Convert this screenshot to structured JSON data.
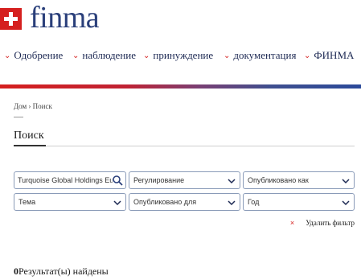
{
  "header": {
    "logo_text": "finma"
  },
  "nav": {
    "items": [
      {
        "label": "Одобрение"
      },
      {
        "label": "наблюдение"
      },
      {
        "label": "принуждение"
      },
      {
        "label": "документация"
      },
      {
        "label": "ФИНМА"
      }
    ]
  },
  "breadcrumb": {
    "text": "Дом › Поиск"
  },
  "page": {
    "title": "Поиск"
  },
  "filters": {
    "search_value": "Turquoise Global Holdings Europe",
    "regulation": "Регулирование",
    "published_as": "Опубликовано как",
    "topic": "Тема",
    "published_for": "Опубликовано для",
    "year": "Год",
    "clear_label": "Удалить фильтр",
    "clear_icon": "×"
  },
  "results": {
    "count": "0",
    "label": "Результат(ы) найдены"
  },
  "colors": {
    "brand_red": "#d5201f",
    "brand_blue": "#2a3f7a"
  }
}
